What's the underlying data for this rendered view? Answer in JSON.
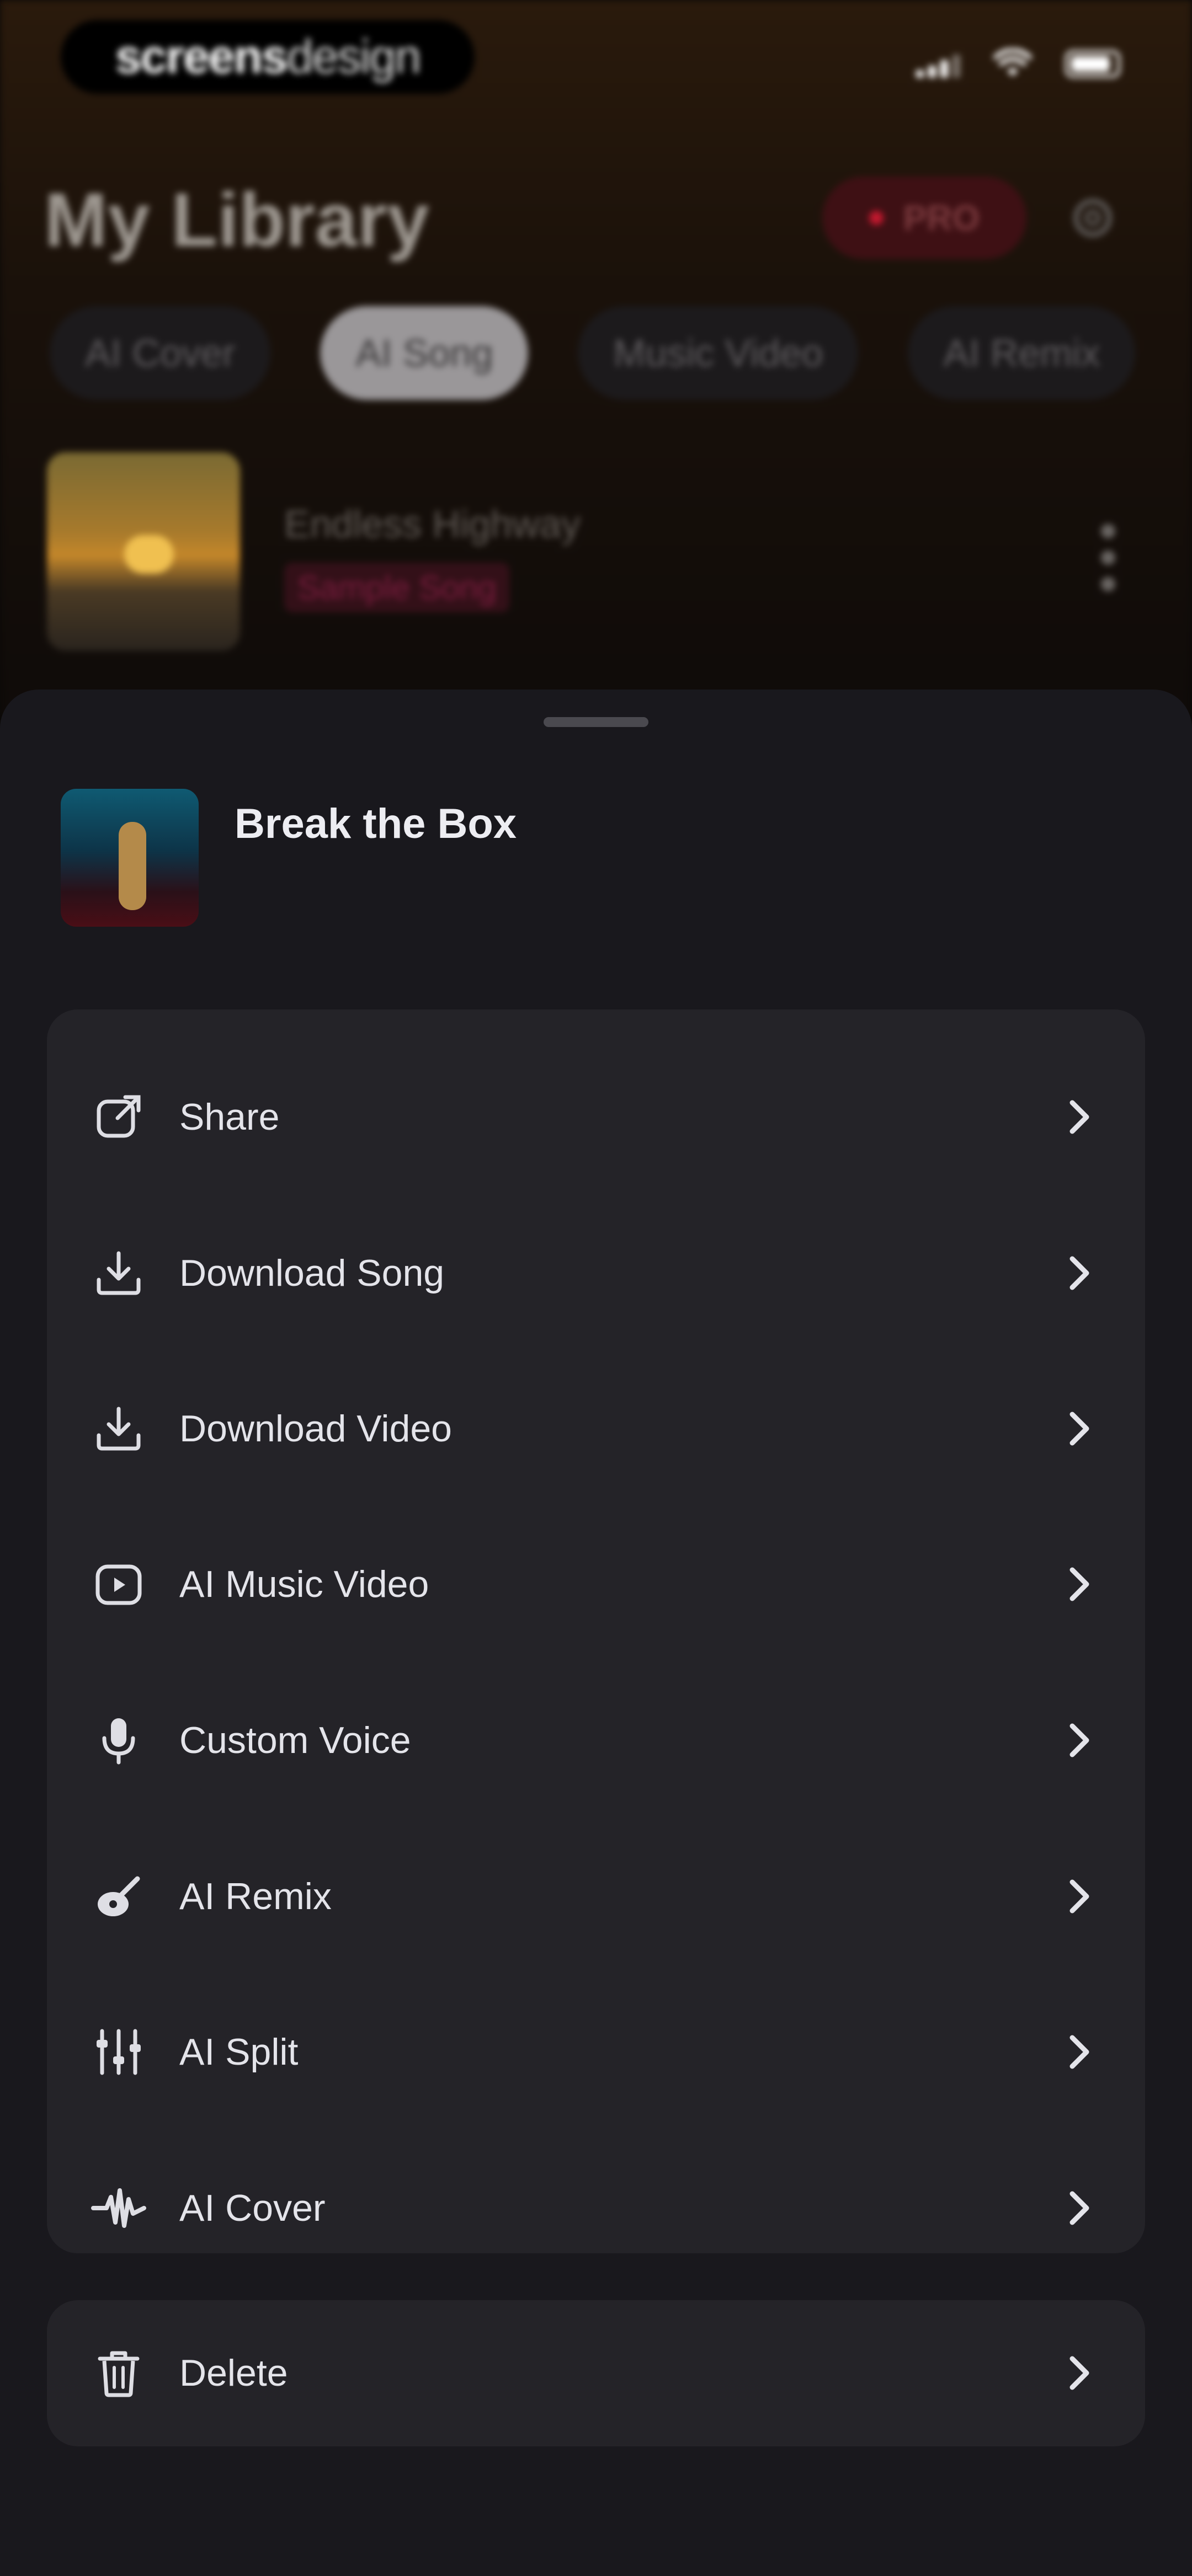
{
  "status_bar": {
    "brand": {
      "bold": "screens",
      "thin": "design"
    }
  },
  "header": {
    "title": "My Library",
    "pro_label": "PRO"
  },
  "tabs": [
    {
      "label": "AI Cover",
      "active": false
    },
    {
      "label": "AI Song",
      "active": true
    },
    {
      "label": "Music Video",
      "active": false
    },
    {
      "label": "AI Remix",
      "active": false
    }
  ],
  "library_items": [
    {
      "title": "Endless Highway",
      "tag": "Sample Song"
    }
  ],
  "sheet": {
    "title": "Break the Box",
    "menu": [
      {
        "label": "Share",
        "icon": "share-icon"
      },
      {
        "label": "Download Song",
        "icon": "download-icon"
      },
      {
        "label": "Download Video",
        "icon": "download-icon"
      },
      {
        "label": "AI Music Video",
        "icon": "video-play-icon"
      },
      {
        "label": "Custom Voice",
        "icon": "microphone-icon"
      },
      {
        "label": "AI Remix",
        "icon": "guitar-icon"
      },
      {
        "label": "AI Split",
        "icon": "sliders-icon"
      },
      {
        "label": "AI Cover",
        "icon": "waveform-icon"
      }
    ],
    "delete": {
      "label": "Delete",
      "icon": "trash-icon"
    }
  },
  "colors": {
    "accent_pro": "#c2182e",
    "sheet_bg": "#19181d",
    "card_bg": "#242328"
  }
}
